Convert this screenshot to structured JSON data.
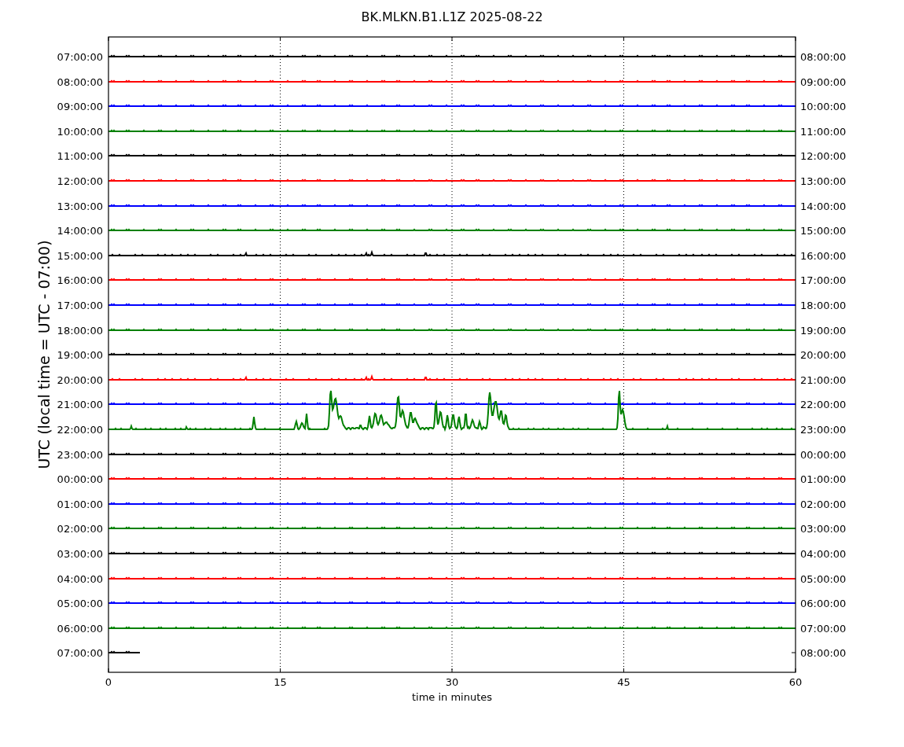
{
  "title": "BK.MLKN.B1.L1Z 2025-08-22",
  "ylabel": "UTC (local time = UTC - 07:00)",
  "xlabel": "time in minutes",
  "xticks": [
    "0",
    "15",
    "30",
    "45",
    "60"
  ],
  "traces": [
    {
      "left_label": "07:00:00",
      "right_label": "08:00:00",
      "color": "#000000",
      "kind": "quiet",
      "level": 1
    },
    {
      "left_label": "08:00:00",
      "right_label": "09:00:00",
      "color": "#ff0000",
      "kind": "quiet",
      "level": 1
    },
    {
      "left_label": "09:00:00",
      "right_label": "10:00:00",
      "color": "#0000ff",
      "kind": "quiet",
      "level": 1
    },
    {
      "left_label": "10:00:00",
      "right_label": "11:00:00",
      "color": "#008000",
      "kind": "quiet",
      "level": 1
    },
    {
      "left_label": "11:00:00",
      "right_label": "12:00:00",
      "color": "#000000",
      "kind": "quiet",
      "level": 1
    },
    {
      "left_label": "12:00:00",
      "right_label": "13:00:00",
      "color": "#ff0000",
      "kind": "quiet",
      "level": 1
    },
    {
      "left_label": "13:00:00",
      "right_label": "14:00:00",
      "color": "#0000ff",
      "kind": "quiet",
      "level": 1
    },
    {
      "left_label": "14:00:00",
      "right_label": "15:00:00",
      "color": "#008000",
      "kind": "quiet",
      "level": 1
    },
    {
      "left_label": "15:00:00",
      "right_label": "16:00:00",
      "color": "#000000",
      "kind": "blips",
      "level": 1
    },
    {
      "left_label": "16:00:00",
      "right_label": "17:00:00",
      "color": "#ff0000",
      "kind": "quiet",
      "level": 1
    },
    {
      "left_label": "17:00:00",
      "right_label": "18:00:00",
      "color": "#0000ff",
      "kind": "quiet",
      "level": 1
    },
    {
      "left_label": "18:00:00",
      "right_label": "19:00:00",
      "color": "#008000",
      "kind": "quiet",
      "level": 1
    },
    {
      "left_label": "19:00:00",
      "right_label": "20:00:00",
      "color": "#000000",
      "kind": "quiet",
      "level": 1
    },
    {
      "left_label": "20:00:00",
      "right_label": "21:00:00",
      "color": "#ff0000",
      "kind": "blips",
      "level": 1
    },
    {
      "left_label": "21:00:00",
      "right_label": "22:00:00",
      "color": "#0000ff",
      "kind": "quiet",
      "level": 1
    },
    {
      "left_label": "22:00:00",
      "right_label": "23:00:00",
      "color": "#008000",
      "kind": "active",
      "level": 1
    },
    {
      "left_label": "23:00:00",
      "right_label": "00:00:00",
      "color": "#000000",
      "kind": "quiet",
      "level": 1
    },
    {
      "left_label": "00:00:00",
      "right_label": "01:00:00",
      "color": "#ff0000",
      "kind": "quiet",
      "level": 1
    },
    {
      "left_label": "01:00:00",
      "right_label": "02:00:00",
      "color": "#0000ff",
      "kind": "quiet",
      "level": 1
    },
    {
      "left_label": "02:00:00",
      "right_label": "03:00:00",
      "color": "#008000",
      "kind": "quiet",
      "level": 1
    },
    {
      "left_label": "03:00:00",
      "right_label": "04:00:00",
      "color": "#000000",
      "kind": "quiet",
      "level": 1
    },
    {
      "left_label": "04:00:00",
      "right_label": "05:00:00",
      "color": "#ff0000",
      "kind": "quiet",
      "level": 1
    },
    {
      "left_label": "05:00:00",
      "right_label": "06:00:00",
      "color": "#0000ff",
      "kind": "quiet",
      "level": 1
    },
    {
      "left_label": "06:00:00",
      "right_label": "07:00:00",
      "color": "#008000",
      "kind": "quiet",
      "level": 1
    },
    {
      "left_label": "07:00:00",
      "right_label": "08:00:00",
      "color": "#000000",
      "kind": "quiet",
      "level": 0.046
    }
  ]
}
